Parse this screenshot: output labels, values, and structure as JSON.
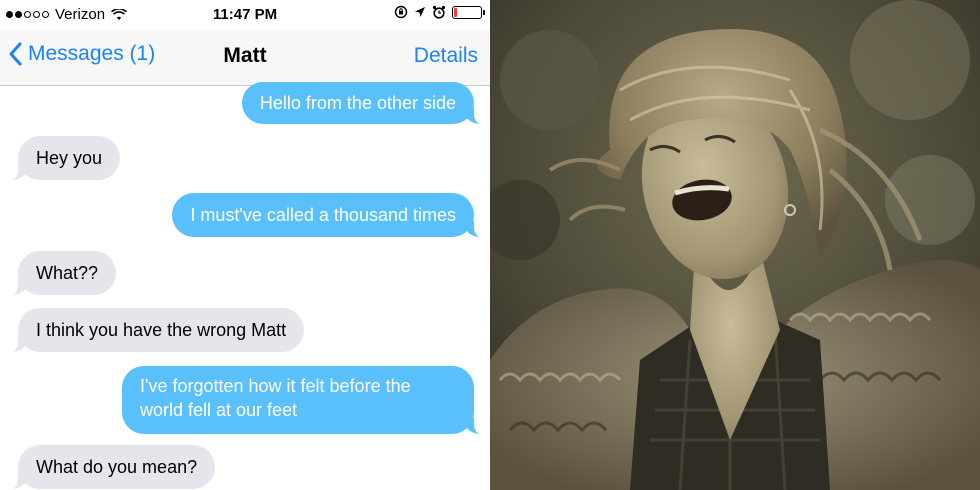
{
  "status_bar": {
    "carrier": "Verizon",
    "time": "11:47 PM",
    "signal_filled": 2,
    "signal_total": 5,
    "battery_level": 0.12,
    "battery_color": "#ff3b30"
  },
  "nav": {
    "back_label": "Messages (1)",
    "title": "Matt",
    "details_label": "Details",
    "accent_color": "#1a82fb"
  },
  "messages": [
    {
      "side": "out",
      "text": "Hello from the other side"
    },
    {
      "side": "in",
      "text": "Hey you"
    },
    {
      "side": "out",
      "text": "I must've called a thousand times"
    },
    {
      "side": "in",
      "text": "What??"
    },
    {
      "side": "in",
      "text": "I think you have the wrong Matt"
    },
    {
      "side": "out",
      "text": "I've forgotten how it felt before the world fell at our feet"
    },
    {
      "side": "in",
      "text": "What do you mean?"
    }
  ],
  "colors": {
    "outgoing_bubble": "#5ac0fb",
    "incoming_bubble": "#e6e5eb"
  },
  "photo": {
    "icon": "singer-photo"
  }
}
